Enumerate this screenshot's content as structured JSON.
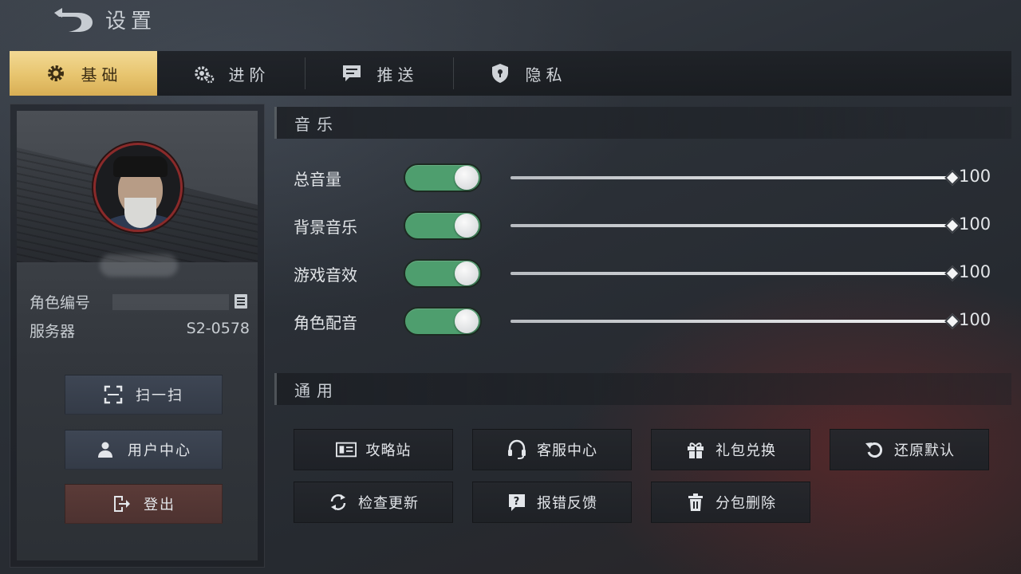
{
  "header": {
    "title": "设置"
  },
  "tabs": [
    {
      "label": "基础",
      "icon": "gear-icon",
      "active": true
    },
    {
      "label": "进阶",
      "icon": "gears-icon",
      "active": false
    },
    {
      "label": "推送",
      "icon": "message-icon",
      "active": false
    },
    {
      "label": "隐私",
      "icon": "shield-icon",
      "active": false
    }
  ],
  "profile": {
    "id_label": "角色编号",
    "server_label": "服务器",
    "server_value": "S2-0578",
    "buttons": [
      {
        "label": "扫一扫",
        "icon": "scan-icon"
      },
      {
        "label": "用户中心",
        "icon": "user-icon"
      },
      {
        "label": "登出",
        "icon": "logout-icon"
      }
    ]
  },
  "music": {
    "title": "音乐",
    "rows": [
      {
        "label": "总音量",
        "value": "100",
        "level": 1.0,
        "enabled": true
      },
      {
        "label": "背景音乐",
        "value": "100",
        "level": 1.0,
        "enabled": true
      },
      {
        "label": "游戏音效",
        "value": "100",
        "level": 1.0,
        "enabled": true
      },
      {
        "label": "角色配音",
        "value": "100",
        "level": 1.0,
        "enabled": true
      }
    ]
  },
  "general": {
    "title": "通用",
    "buttons": [
      {
        "label": "攻略站",
        "icon": "guide-icon"
      },
      {
        "label": "客服中心",
        "icon": "headset-icon"
      },
      {
        "label": "礼包兑换",
        "icon": "gift-icon"
      },
      {
        "label": "还原默认",
        "icon": "reset-icon"
      },
      {
        "label": "检查更新",
        "icon": "refresh-icon"
      },
      {
        "label": "报错反馈",
        "icon": "report-icon"
      },
      {
        "label": "分包删除",
        "icon": "trash-icon"
      }
    ]
  },
  "colors": {
    "accent": "#e7c46e",
    "toggle_on": "#4e9e6e",
    "logout": "#5b3b38"
  }
}
